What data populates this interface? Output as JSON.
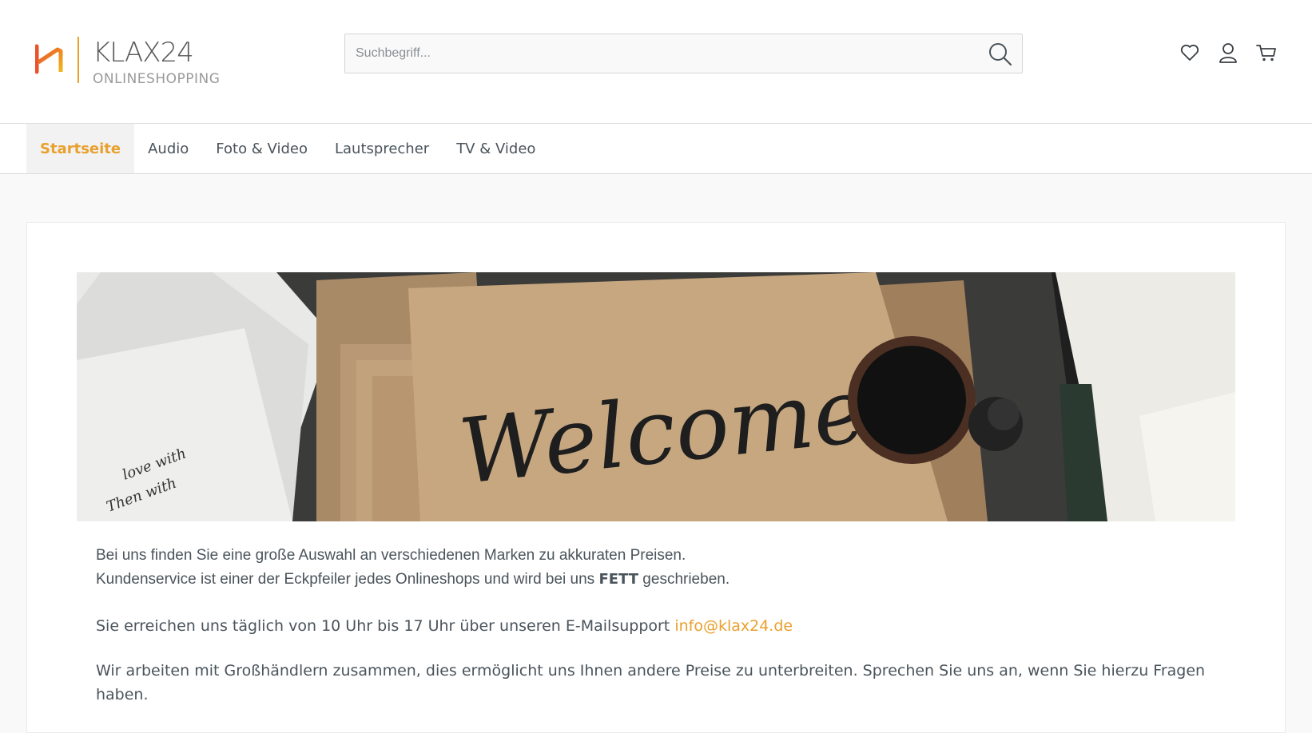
{
  "brand": {
    "name": "KLAX24",
    "tagline": "ONLINESHOPPING",
    "logo_colors": [
      "#f2b61c",
      "#e8532a",
      "#e9a02d"
    ]
  },
  "search": {
    "placeholder": "Suchbegriff...",
    "icon": "search-icon"
  },
  "header_actions": [
    {
      "icon": "heart-icon"
    },
    {
      "icon": "user-icon"
    },
    {
      "icon": "cart-icon"
    }
  ],
  "nav": {
    "items": [
      {
        "label": "Startseite",
        "active": true
      },
      {
        "label": "Audio",
        "active": false
      },
      {
        "label": "Foto & Video",
        "active": false
      },
      {
        "label": "Lautsprecher",
        "active": false
      },
      {
        "label": "TV & Video",
        "active": false
      }
    ]
  },
  "content": {
    "banner_text": "Welcome!",
    "line1": "Bei uns finden Sie eine große Auswahl an verschiedenen Marken zu akkuraten Preisen.",
    "line2_prefix": "Kundenservice ist einer der Eckpfeiler jedes Onlineshops und wird bei uns ",
    "line2_bold": "FETT",
    "line2_suffix": " geschrieben.",
    "contact_prefix": "Sie erreichen uns täglich von 10 Uhr bis 17 Uhr über unseren E-Mailsupport ",
    "contact_email": "info@klax24.de",
    "wholesale": "Wir arbeiten mit Großhändlern zusammen, dies ermöglicht uns Ihnen andere Preise zu unterbreiten. Sprechen Sie uns an, wenn Sie hierzu Fragen haben."
  },
  "colors": {
    "accent": "#e9a02d",
    "text": "#4a545b",
    "background": "#f9f9f9"
  }
}
